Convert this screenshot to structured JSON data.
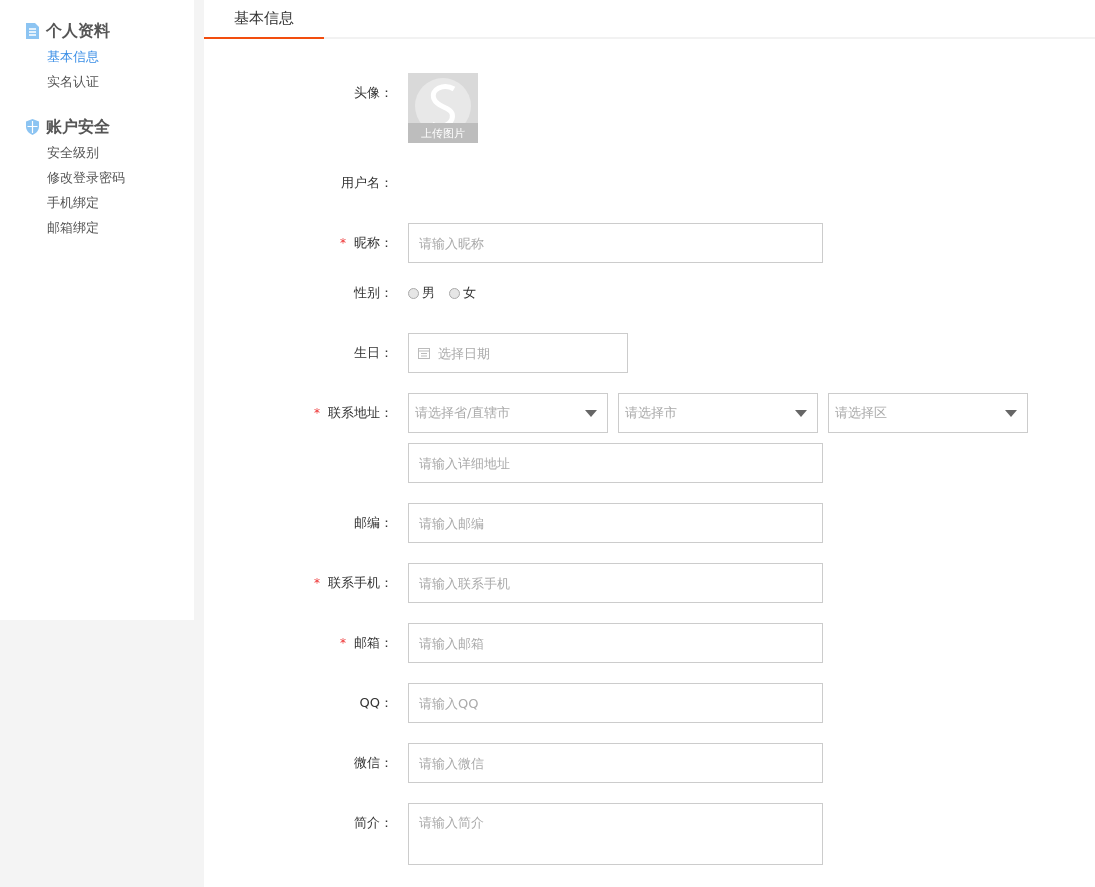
{
  "sidebar": {
    "sections": [
      {
        "kind": "doc",
        "title": "个人资料",
        "items": [
          {
            "label": "基本信息",
            "selected": true
          },
          {
            "label": "实名认证",
            "selected": false
          }
        ]
      },
      {
        "kind": "shield",
        "title": "账户安全",
        "items": [
          {
            "label": "安全级别",
            "selected": false
          },
          {
            "label": "修改登录密码",
            "selected": false
          },
          {
            "label": "手机绑定",
            "selected": false
          },
          {
            "label": "邮箱绑定",
            "selected": false
          }
        ]
      }
    ]
  },
  "tabs": [
    {
      "label": "基本信息",
      "selected": true
    }
  ],
  "form": {
    "rows": [
      {
        "kind": "avatar",
        "label": "头像：",
        "caption": "上传图片"
      },
      {
        "kind": "text",
        "label": "用户名："
      },
      {
        "kind": "input",
        "label": "昵称：",
        "required_mark": "*",
        "placeholder": "请输入昵称"
      },
      {
        "kind": "radio",
        "label": "性别：",
        "options": [
          {
            "label": "男",
            "selected": false
          },
          {
            "label": "女",
            "selected": false
          }
        ]
      },
      {
        "kind": "date",
        "label": "生日：",
        "placeholder": "选择日期"
      },
      {
        "kind": "address",
        "label": "联系地址：",
        "required_mark": "*",
        "selects": [
          "请选择省/直辖市",
          "请选择市",
          "请选择区"
        ],
        "placeholder": "请输入详细地址"
      },
      {
        "kind": "input",
        "label": "邮编：",
        "placeholder": "请输入邮编"
      },
      {
        "kind": "input",
        "label": "联系手机：",
        "required_mark": "*",
        "placeholder": "请输入联系手机"
      },
      {
        "kind": "input",
        "label": "邮箱：",
        "required_mark": "*",
        "placeholder": "请输入邮箱"
      },
      {
        "kind": "input",
        "label": "QQ：",
        "placeholder": "请输入QQ"
      },
      {
        "kind": "input",
        "label": "微信：",
        "placeholder": "请输入微信"
      },
      {
        "kind": "textarea",
        "label": "简介：",
        "placeholder": "请输入简介"
      }
    ]
  }
}
